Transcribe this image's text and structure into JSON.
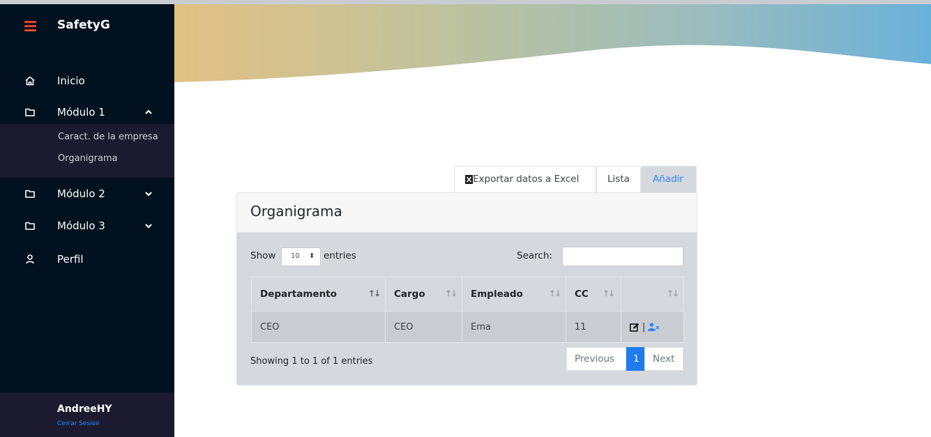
{
  "sidebar": {
    "brand": "SafetyG",
    "items": [
      {
        "label": "Inicio"
      },
      {
        "label": "Módulo 1"
      },
      {
        "label": "Módulo 2"
      },
      {
        "label": "Módulo 3"
      },
      {
        "label": "Perfil"
      }
    ],
    "submenu": [
      "Caract. de la empresa",
      "Organigrama"
    ],
    "user": {
      "name": "AndreeHY",
      "logout": "Cerrar Sesion"
    }
  },
  "colors": {
    "sidebar_bg": "#01111f",
    "submenu_bg": "#1b1a2e",
    "accent": "#2f86ff",
    "hamburger": "#e8462a",
    "banner_left": "#e2c184",
    "banner_right": "#69b1d9"
  },
  "tabs": [
    {
      "label": "Exportar datos a Excel",
      "icon": "excel-icon"
    },
    {
      "label": "Lista"
    },
    {
      "label": "Añadir",
      "active": true
    }
  ],
  "card": {
    "title": "Organigrama",
    "show_label": "Show",
    "page_size": "10",
    "entries_label": "entries",
    "search_label": "Search:",
    "search_value": ""
  },
  "table": {
    "headers": [
      "Departamento",
      "Cargo",
      "Empleado",
      "CC",
      ""
    ],
    "sort_glyph": "↑↓",
    "rows": [
      {
        "departamento": "CEO",
        "cargo": "CEO",
        "empleado": "Ema",
        "cc": "11",
        "separator": "|"
      }
    ]
  },
  "footer": {
    "info": "Showing 1 to 1 of 1 entries",
    "previous": "Previous",
    "current_page": "1",
    "next": "Next"
  }
}
